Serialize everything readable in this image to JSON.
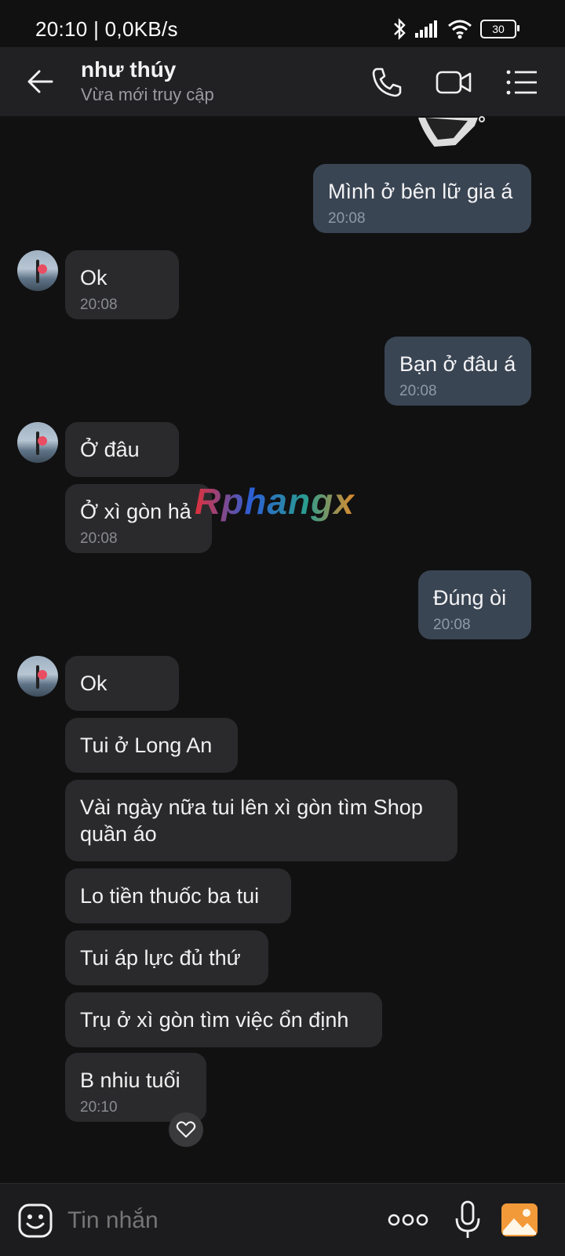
{
  "status_bar": {
    "text": "20:10 | 0,0KB/s",
    "battery": "30"
  },
  "header": {
    "name": "như thúy",
    "status": "Vừa mới truy cập"
  },
  "watermark": "Rphangx",
  "messages": [
    {
      "dir": "out",
      "text": "Mình ở bên lữ gia á",
      "time": "20:08"
    },
    {
      "dir": "in",
      "text": "Ok",
      "time": "20:08"
    },
    {
      "dir": "out",
      "text": "Bạn ở đâu á",
      "time": "20:08"
    },
    {
      "dir": "in",
      "text": "Ở đâu",
      "time": ""
    },
    {
      "dir": "in",
      "text": "Ở xì gòn hả",
      "time": "20:08"
    },
    {
      "dir": "out",
      "text": "Đúng òi",
      "time": "20:08"
    },
    {
      "dir": "in",
      "text": "Ok",
      "time": ""
    },
    {
      "dir": "in",
      "text": "Tui ở Long An",
      "time": ""
    },
    {
      "dir": "in",
      "text": "Vài ngày nữa tui lên xì gòn tìm Shop",
      "text2": "quần áo",
      "time": ""
    },
    {
      "dir": "in",
      "text": "Lo tiền thuốc ba tui",
      "time": ""
    },
    {
      "dir": "in",
      "text": "Tui áp lực đủ thứ",
      "time": ""
    },
    {
      "dir": "in",
      "text": "Trụ ở xì gòn tìm việc ổn định",
      "time": ""
    },
    {
      "dir": "in",
      "text": "B nhiu tuổi",
      "time": "20:10"
    }
  ],
  "input": {
    "placeholder": "Tin nhắn"
  },
  "colors": {
    "incoming": "#2a2a2c",
    "outgoing": "#3a4553",
    "background": "#111112",
    "accent_image_button": "#f29a3a"
  }
}
